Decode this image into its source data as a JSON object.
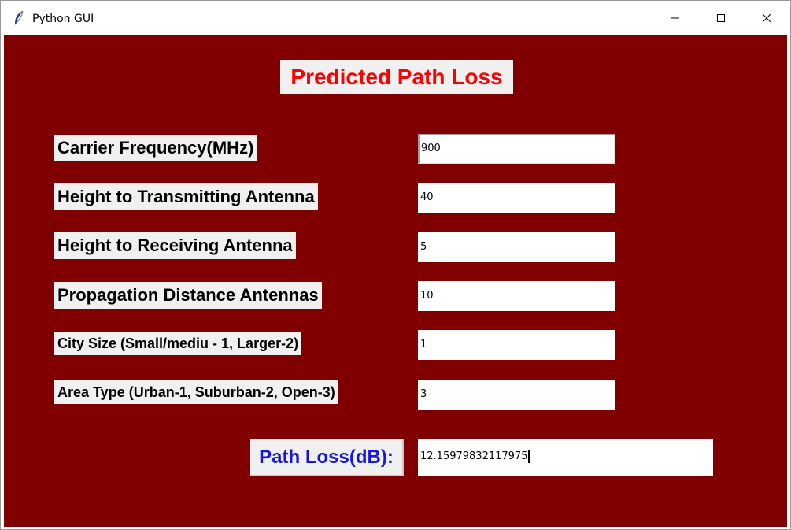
{
  "window": {
    "title": "Python GUI",
    "icon": "feather-icon",
    "controls": [
      "minimize-icon",
      "maximize-icon",
      "close-icon"
    ]
  },
  "colors": {
    "background": "#800000",
    "heading_text": "#ff0000",
    "result_label_text": "#1515e8",
    "label_background": "#f0f0f0"
  },
  "heading": "Predicted Path Loss",
  "fields": [
    {
      "label": "Carrier Frequency(MHz)",
      "value": "900"
    },
    {
      "label": "Height to Transmitting Antenna",
      "value": "40"
    },
    {
      "label": "Height to Receiving Antenna",
      "value": "5"
    },
    {
      "label": "Propagation Distance Antennas",
      "value": "10"
    },
    {
      "label": "City Size (Small/mediu - 1, Larger-2)",
      "value": "1"
    },
    {
      "label": "Area Type (Urban-1, Suburban-2, Open-3)",
      "value": "3"
    }
  ],
  "result": {
    "label": "Path Loss(dB):",
    "value": "12.15979832117975"
  }
}
